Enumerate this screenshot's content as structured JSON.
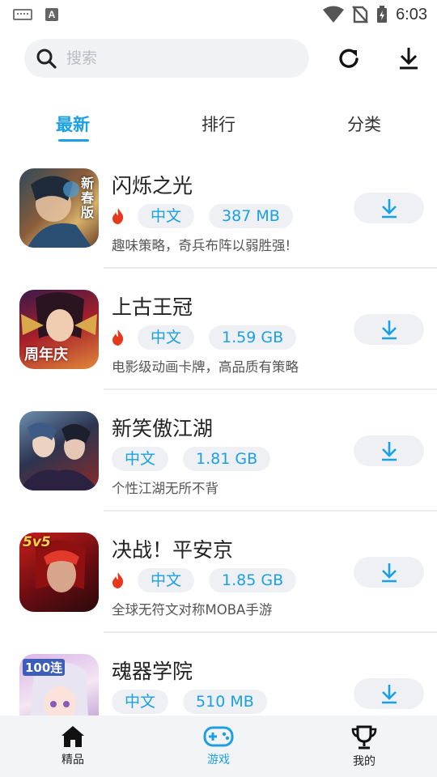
{
  "status_bar": {
    "time": "6:03",
    "a_badge": "A"
  },
  "search": {
    "placeholder": "搜索"
  },
  "tabs": [
    {
      "label": "最新",
      "active": true
    },
    {
      "label": "排行",
      "active": false
    },
    {
      "label": "分类",
      "active": false
    }
  ],
  "apps": [
    {
      "title": "闪烁之光",
      "hot": true,
      "language": "中文",
      "size": "387 MB",
      "desc": "趣味策略，奇兵布阵以弱胜强!",
      "thumb_badge": "新春版"
    },
    {
      "title": "上古王冠",
      "hot": true,
      "language": "中文",
      "size": "1.59 GB",
      "desc": "电影级动画卡牌，高品质有策略",
      "thumb_badge": "周年庆"
    },
    {
      "title": "新笑傲江湖",
      "hot": false,
      "language": "中文",
      "size": "1.81 GB",
      "desc": "个性江湖无所不背",
      "thumb_badge": ""
    },
    {
      "title": "决战！平安京",
      "hot": true,
      "language": "中文",
      "size": "1.85 GB",
      "desc": "全球无符文对称MOBA手游",
      "thumb_badge": "5v5"
    },
    {
      "title": "魂器学院",
      "hot": false,
      "language": "中文",
      "size": "510 MB",
      "desc": "",
      "thumb_badge": "100连"
    }
  ],
  "bottom_nav": [
    {
      "label": "精品",
      "icon": "home-icon",
      "active": false
    },
    {
      "label": "游戏",
      "icon": "gamepad-icon",
      "active": true
    },
    {
      "label": "我的",
      "icon": "trophy-icon",
      "active": false
    }
  ],
  "colors": {
    "accent": "#1aa0e6",
    "hot": "#e8381c",
    "tag_bg": "#eef0f3"
  }
}
